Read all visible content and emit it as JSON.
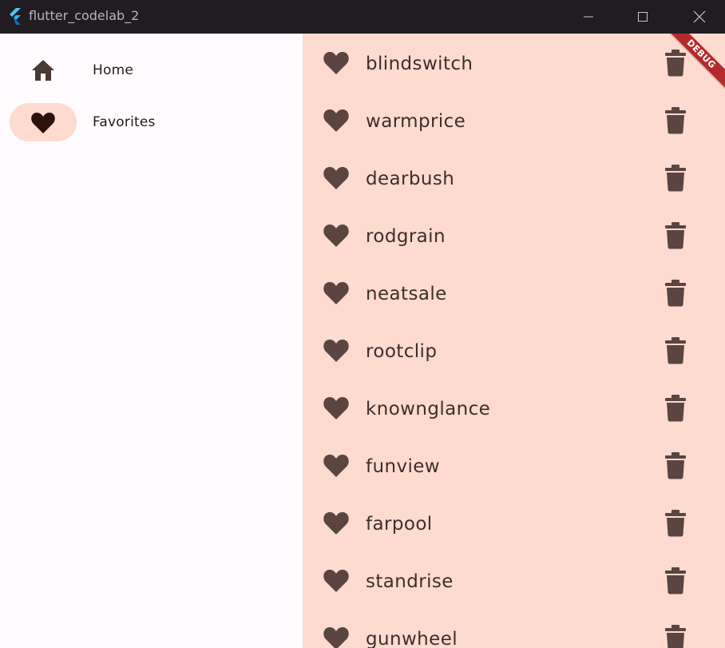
{
  "window": {
    "title": "flutter_codelab_2",
    "icons": {
      "app": "flutter-logo-icon",
      "minimize": "minimize-icon",
      "maximize": "maximize-icon",
      "close": "close-icon"
    }
  },
  "rail": {
    "items": [
      {
        "label": "Home",
        "icon": "home-icon",
        "selected": false
      },
      {
        "label": "Favorites",
        "icon": "heart-icon",
        "selected": true
      }
    ]
  },
  "favorites": {
    "words": [
      "blindswitch",
      "warmprice",
      "dearbush",
      "rodgrain",
      "neatsale",
      "rootclip",
      "knownglance",
      "funview",
      "farpool",
      "standrise",
      "gunwheel"
    ],
    "item_icon": "heart-icon",
    "action_icon": "delete-icon"
  },
  "debug_banner": {
    "label": "DEBUG"
  },
  "colors": {
    "content_bg": "#ffdbcf",
    "rail_indicator": "#ffdbcf",
    "icon": "#5a4540",
    "titlebar": "#201c22",
    "banner": "#b42b2b"
  }
}
